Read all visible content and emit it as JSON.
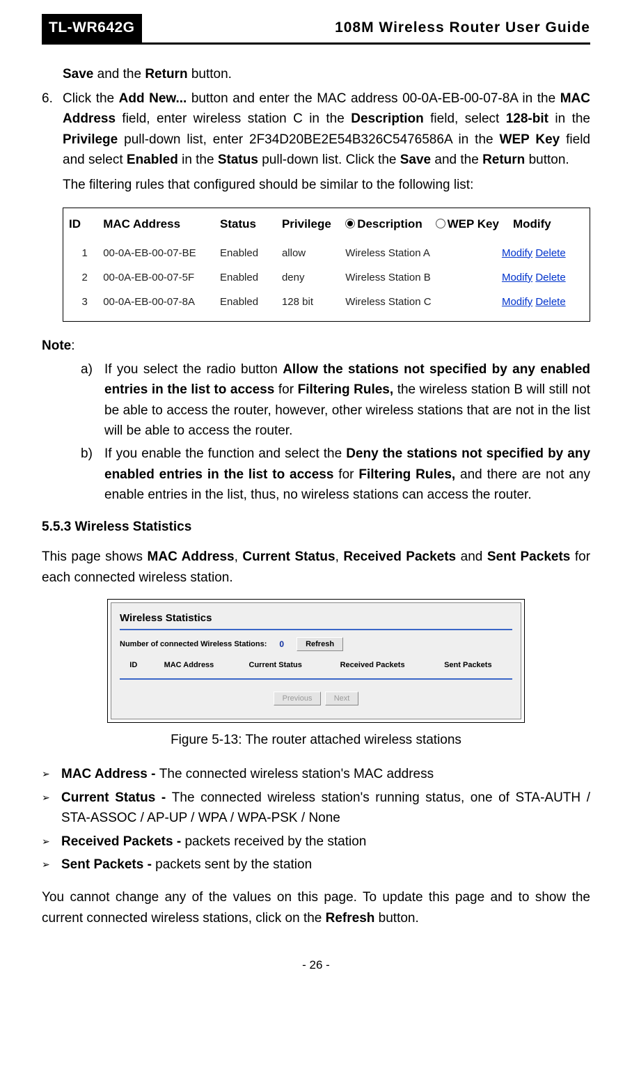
{
  "header": {
    "model": "TL-WR642G",
    "title": "108M Wireless Router User Guide"
  },
  "intro_line": {
    "save": "Save",
    "mid": " and the ",
    "return": "Return",
    "tail": " button."
  },
  "step6": {
    "num": "6.",
    "t1": "Click the ",
    "add_new": "Add New...",
    "t2": " button and enter the MAC address 00-0A-EB-00-07-8A in the ",
    "mac_address": "MAC Address",
    "t3": " field, enter wireless station C in the ",
    "description": "Description",
    "t4": " field, select ",
    "bit128": "128-bit",
    "t5": " in the ",
    "privilege": "Privilege",
    "t6": " pull-down list, enter 2F34D20BE2E54B326C5476586A in the ",
    "wep_key": "WEP Key",
    "t7": " field and select ",
    "enabled": "Enabled",
    "t8": " in the ",
    "status": "Status",
    "t9": " pull-down list. Click the ",
    "save": "Save",
    "t10": " and the ",
    "return": "Return",
    "t11": " button.",
    "followup": "The filtering rules that configured should be similar to the following list:"
  },
  "filter_table": {
    "headers": {
      "id": "ID",
      "mac": "MAC Address",
      "status": "Status",
      "privilege": "Privilege",
      "description": "Description",
      "wep_key": "WEP Key",
      "modify": "Modify"
    },
    "rows": [
      {
        "id": "1",
        "mac": "00-0A-EB-00-07-BE",
        "status": "Enabled",
        "privilege": "allow",
        "desc": "Wireless Station A",
        "modify": "Modify",
        "delete": "Delete"
      },
      {
        "id": "2",
        "mac": "00-0A-EB-00-07-5F",
        "status": "Enabled",
        "privilege": "deny",
        "desc": "Wireless Station B",
        "modify": "Modify",
        "delete": "Delete"
      },
      {
        "id": "3",
        "mac": "00-0A-EB-00-07-8A",
        "status": "Enabled",
        "privilege": "128 bit",
        "desc": "Wireless Station C",
        "modify": "Modify",
        "delete": "Delete"
      }
    ]
  },
  "note": {
    "label": "Note",
    "colon": ":",
    "a": {
      "lab": "a)",
      "t1": "If you select the radio button ",
      "b1": "Allow the stations not specified by any enabled entries in the list to access",
      "t2": " for ",
      "b2": "Filtering Rules,",
      "t3": " the wireless station B will still not be able to access the router, however, other wireless stations that are not in the list will be able to access the router."
    },
    "b": {
      "lab": "b)",
      "t1": "If you enable the function and select the ",
      "b1": "Deny the stations not specified by any enabled entries in the list to access",
      "t2": " for ",
      "b2": "Filtering Rules,",
      "t3": " and there are not any enable entries in the list, thus, no wireless stations can access the router."
    }
  },
  "section": "5.5.3 Wireless Statistics",
  "section_intro": {
    "t1": "This page shows ",
    "b1": "MAC Address",
    "c1": ", ",
    "b2": "Current Status",
    "c2": ", ",
    "b3": "Received Packets",
    "c3": " and ",
    "b4": "Sent Packets",
    "t2": " for each connected wireless station."
  },
  "wstats": {
    "title": "Wireless Statistics",
    "count_label": "Number of connected Wireless Stations:",
    "count_value": "0",
    "refresh": "Refresh",
    "headers": {
      "id": "ID",
      "mac": "MAC Address",
      "status": "Current Status",
      "rx": "Received Packets",
      "tx": "Sent Packets"
    },
    "prev": "Previous",
    "next": "Next"
  },
  "figure_caption": "Figure 5-13: The router attached wireless stations",
  "bullets": {
    "mark": "➢",
    "items": [
      {
        "head": "MAC Address - ",
        "body": "The connected wireless station's MAC address"
      },
      {
        "head": "Current Status - ",
        "body": "The connected wireless station's running status, one of STA-AUTH / STA-ASSOC / AP-UP / WPA / WPA-PSK / None"
      },
      {
        "head": "Received Packets - ",
        "body": "packets received by the station"
      },
      {
        "head": "Sent Packets - ",
        "body": "packets sent by the station"
      }
    ]
  },
  "closing": {
    "t1": "You cannot change any of the values on this page. To update this page and to show the current connected wireless stations, click on the ",
    "b1": "Refresh",
    "t2": " button."
  },
  "page_number": "- 26 -"
}
